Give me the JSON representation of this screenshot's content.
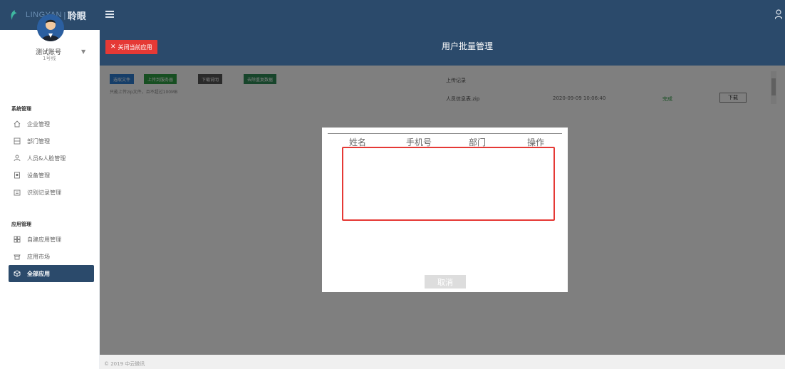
{
  "app": {
    "logo_en": "LINGYAN",
    "logo_sep": "|",
    "logo_cn": "聆眼"
  },
  "sidebar": {
    "account_name": "测试账号",
    "account_sub": "1号线",
    "section_system": "系统管理",
    "system_items": [
      {
        "label": "企业管理",
        "icon": "home-icon"
      },
      {
        "label": "部门管理",
        "icon": "department-icon"
      },
      {
        "label": "人员&人脸管理",
        "icon": "person-icon"
      },
      {
        "label": "设备管理",
        "icon": "device-icon"
      },
      {
        "label": "识别记录管理",
        "icon": "record-icon"
      }
    ],
    "section_apps": "应用管理",
    "app_items": [
      {
        "label": "自建应用管理",
        "icon": "grid-icon"
      },
      {
        "label": "应用市场",
        "icon": "store-icon"
      },
      {
        "label": "全部应用",
        "icon": "box-icon",
        "active": true
      }
    ]
  },
  "header": {
    "close_app": "关闭当前应用",
    "page_title": "用户批量管理"
  },
  "toolbar": {
    "choose_file": "选取文件",
    "upload": "上传到服务器",
    "download_template": "下载说明",
    "clear_duplicates": "去除重复数据",
    "hint": "只能上传zip文件，且不超过100MB"
  },
  "upload_records": {
    "title": "上传记录",
    "rows": [
      {
        "name": "人员信息表.zip",
        "time": "2020-09-09 10:06:40",
        "status": "完成",
        "action": "下载"
      }
    ]
  },
  "modal": {
    "columns": [
      "姓名",
      "手机号",
      "部门",
      "操作"
    ],
    "cancel": "取消"
  },
  "footer": {
    "copyright": "© 2019 中云微讯"
  },
  "colors": {
    "primary": "#2b4a6b",
    "danger": "#e53935",
    "upload_btn": "#2e9e44",
    "choose_btn": "#2d7dd2",
    "dark_btn": "#555555",
    "clear_btn": "#2e8b57"
  }
}
